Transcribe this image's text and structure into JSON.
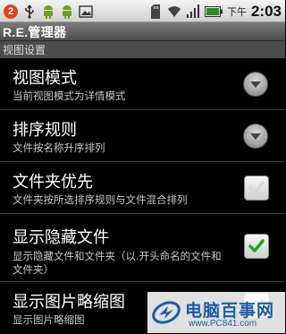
{
  "status_bar": {
    "notification_count": "2",
    "time_period": "下午",
    "time": "2:03",
    "icons": [
      "usb-icon",
      "android-icon",
      "android-icon",
      "picture-icon",
      "sd-card-icon",
      "wifi-icon",
      "signal-icon",
      "battery-icon"
    ]
  },
  "title_bar": {
    "title": "R.E.管理器"
  },
  "category": {
    "title": "视图设置"
  },
  "preferences": [
    {
      "title": "视图模式",
      "summary": "当前视图模式为详情模式",
      "widget": "dropdown"
    },
    {
      "title": "排序规则",
      "summary": "文件按名称升序排列",
      "widget": "dropdown"
    },
    {
      "title": "文件夹优先",
      "summary": "文件夹按所选排序规则与文件混合排列",
      "widget": "checkbox",
      "checked": false
    },
    {
      "title": "显示隐藏文件",
      "summary": "显示隐藏文件和文件夹（以.开头命名的文件和文件夹）",
      "widget": "checkbox",
      "checked": true
    },
    {
      "title": "显示图片略缩图",
      "summary": "显示图片略缩图",
      "widget": "checkbox",
      "checked": true
    }
  ],
  "watermark": {
    "title": "电脑百事网",
    "url": "www.PC841.com"
  },
  "colors": {
    "check_green": "#1fa81f",
    "watermark_blue": "#1e5aa8",
    "badge_red": "#e2421a"
  }
}
